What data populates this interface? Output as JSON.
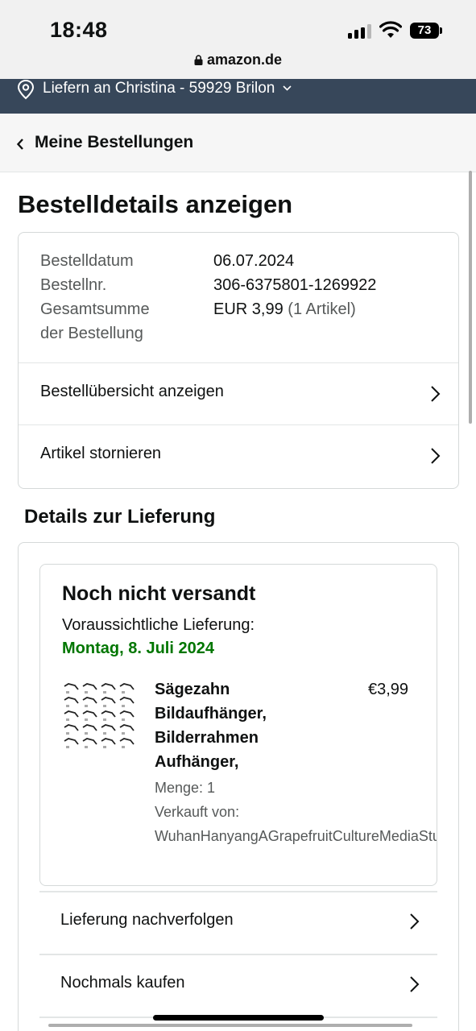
{
  "status_bar": {
    "time": "18:48",
    "battery": "73",
    "url": "amazon.de"
  },
  "header": {
    "deliver_to": "Liefern an Christina - 59929 Brilon",
    "back_label": "Meine Bestellungen"
  },
  "page": {
    "title": "Bestelldetails anzeigen"
  },
  "order_summary": {
    "date_label": "Bestelldatum",
    "date_value": "06.07.2024",
    "number_label": "Bestellnr.",
    "number_value": "306-6375801-1269922",
    "total_label_line1": "Gesamtsumme",
    "total_label_line2": "der Bestellung",
    "total_value": "EUR 3,99",
    "total_items": "(1 Artikel)",
    "links": [
      {
        "label": "Bestellübersicht anzeigen"
      },
      {
        "label": "Artikel stornieren"
      }
    ]
  },
  "delivery": {
    "section_title": "Details zur Lieferung",
    "status": "Noch nicht versandt",
    "eta_label": "Voraussichtliche Lieferung:",
    "eta_date": "Montag, 8. Juli 2024",
    "product": {
      "title_lines": [
        "Sägezahn",
        "Bildaufhänger,",
        "Bilderrahmen",
        "Aufhänger,"
      ],
      "price": "€3,99",
      "quantity": "Menge: 1",
      "seller_label": "Verkauft von:",
      "seller_name": "WuhanHanyangAGrapefruitCultureMediaStud"
    },
    "actions": [
      {
        "label": "Lieferung nachverfolgen"
      },
      {
        "label": "Nochmals kaufen"
      }
    ]
  },
  "colors": {
    "nav_bar": "#37475a",
    "delivery_green": "#007600",
    "border": "#d5d9d9"
  }
}
